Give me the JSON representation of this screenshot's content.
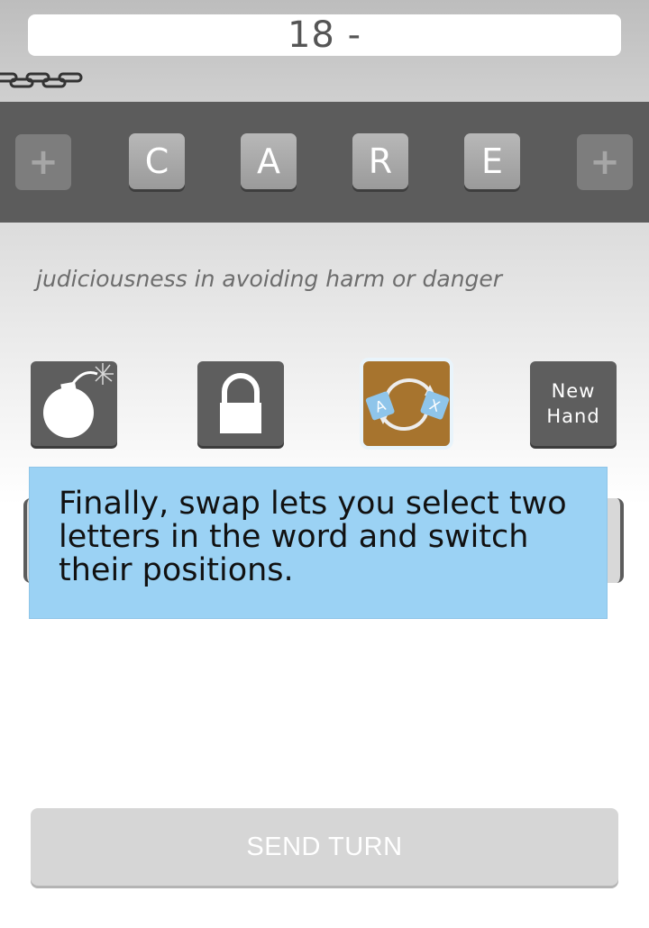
{
  "score": {
    "text": "18 -"
  },
  "word": {
    "tiles": [
      "C",
      "A",
      "R",
      "E"
    ],
    "add_left": "+",
    "add_right": "+"
  },
  "definition": "judiciousness in avoiding harm or danger",
  "powerups": {
    "bomb": {
      "icon": "bomb-icon"
    },
    "lock": {
      "icon": "lock-icon"
    },
    "swap": {
      "icon": "swap-icon",
      "letters": [
        "A",
        "X"
      ]
    },
    "new_hand": {
      "label": "New\nHand"
    }
  },
  "tooltip": {
    "text": "Finally, swap lets you select two letters in the word and switch their positions."
  },
  "send_turn": {
    "label": "SEND TURN"
  },
  "colors": {
    "tray": "#5c5c5c",
    "tile": "#a9a9a9",
    "swap_accent": "#a7742e",
    "tooltip_bg": "#9bd2f4",
    "send_bg": "#d6d6d6"
  }
}
